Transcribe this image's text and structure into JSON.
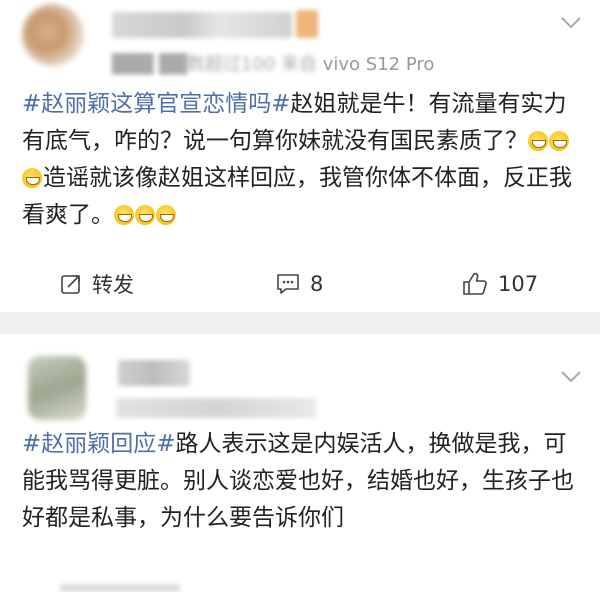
{
  "post1": {
    "username": "███ ██████",
    "meta_blurred": "███ ██数超过100",
    "device_prefix": "来自",
    "device": "vivo S12 Pro",
    "hashtag": "#赵丽颖这算官宣恋情吗#",
    "text_part1": "赵姐就是牛！有流量有实力有底气，咋的？说一句算你妹就没有国民素质了？",
    "text_part2": "造谣就该像赵姐这样回应，我管你体不体面，反正我看爽了。",
    "emoji_name": "grinning-sweat-emoji",
    "actions": {
      "repost_label": "转发",
      "comment_count": "8",
      "like_count": "107"
    }
  },
  "post2": {
    "username": "███",
    "meta_blurred": "██████████",
    "hashtag": "#赵丽颖回应#",
    "text": "路人表示这是内娱活人，换做是我，可能我骂得更脏。别人谈恋爱也好，结婚也好，生孩子也好都是私事，为什么要告诉你们"
  },
  "icons": {
    "repost": "repost-icon",
    "comment": "comment-icon",
    "like": "thumbs-up-icon",
    "menu": "chevron-down-icon"
  }
}
